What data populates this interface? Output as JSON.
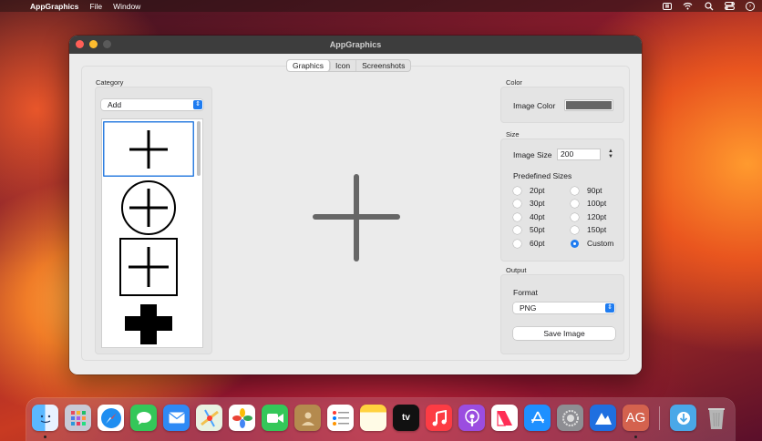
{
  "menubar": {
    "app_name": "AppGraphics",
    "menus": [
      "File",
      "Window"
    ]
  },
  "window": {
    "title": "AppGraphics",
    "tabs": [
      {
        "label": "Graphics",
        "active": true
      },
      {
        "label": "Icon",
        "active": false
      },
      {
        "label": "Screenshots",
        "active": false
      }
    ]
  },
  "category": {
    "group_label": "Category",
    "selected": "Add",
    "items": [
      "plus-icon",
      "circle-plus-icon",
      "square-plus-icon",
      "filled-cross-icon"
    ],
    "selected_index": 0
  },
  "preview": {
    "icon": "plus-icon",
    "color": "#666666"
  },
  "color_group": {
    "group_label": "Color",
    "image_color_label": "Image Color",
    "image_color_value": "#666666"
  },
  "size_group": {
    "group_label": "Size",
    "image_size_label": "Image Size",
    "image_size_value": "200",
    "predefined_label": "Predefined Sizes",
    "options": [
      {
        "label": "20pt",
        "checked": false
      },
      {
        "label": "90pt",
        "checked": false
      },
      {
        "label": "30pt",
        "checked": false
      },
      {
        "label": "100pt",
        "checked": false
      },
      {
        "label": "40pt",
        "checked": false
      },
      {
        "label": "120pt",
        "checked": false
      },
      {
        "label": "50pt",
        "checked": false
      },
      {
        "label": "150pt",
        "checked": false
      },
      {
        "label": "60pt",
        "checked": false
      },
      {
        "label": "Custom",
        "checked": true
      }
    ]
  },
  "output_group": {
    "group_label": "Output",
    "format_label": "Format",
    "format_value": "PNG",
    "save_button": "Save Image"
  },
  "colors": {
    "accent": "#1f7cf0",
    "selection": "#2f7fe0"
  },
  "dock": {
    "apps": [
      "finder-icon",
      "launchpad-icon",
      "safari-icon",
      "messages-icon",
      "mail-icon",
      "maps-icon",
      "photos-icon",
      "facetime-icon",
      "contacts-icon",
      "reminders-icon",
      "notes-icon",
      "apple-tv-icon",
      "music-icon",
      "podcasts-icon",
      "news-icon",
      "app-store-icon",
      "system-settings-icon",
      "affinity-icon",
      "appgraphics-icon",
      "downloads-icon",
      "trash-icon"
    ],
    "tv_label": "tv",
    "appgraphics_label": "AG"
  }
}
